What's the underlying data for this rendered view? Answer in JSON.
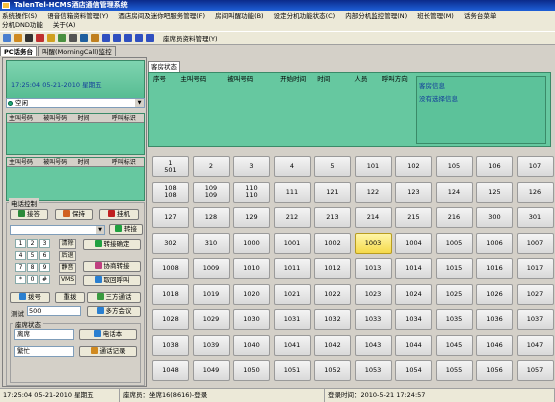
{
  "window": {
    "title": "TalenTel-HCMS酒店通信管理系统"
  },
  "menu": [
    "系统操作(S)",
    "语音信箱资料管理(Y)",
    "酒店房间及迷你吧服务管理(F)",
    "房间叫醒功能(B)",
    "设定分机功能状态(C)",
    "内部分机监控管理(N)",
    "班长管理(M)",
    "话务台菜单",
    "分机DND功能",
    "关于(A)"
  ],
  "toolbar": {
    "label": "座席员资料管理(Y)",
    "icons": [
      "open-icon",
      "filter-icon",
      "clock-icon",
      "ring-icon",
      "flag-icon",
      "users-icon",
      "printer-icon",
      "phone-icon",
      "key-icon",
      "check-icon",
      "check-icon",
      "check-icon",
      "check-icon",
      "check-icon"
    ]
  },
  "tabs": [
    "PC话务台",
    "叫醒(MorningCall)监控"
  ],
  "clock": "17:25:04  05-21-2010 星期五",
  "agent_state": "空闲",
  "queue1_head": [
    "主叫号码",
    "被叫号码",
    "时间",
    "呼叫标识"
  ],
  "queue2_head": [
    "主叫号码",
    "被叫号码",
    "时间",
    "呼叫标识"
  ],
  "control": {
    "title": "电话控制",
    "answer": "接答",
    "hold": "保持",
    "hangup": "挂机",
    "transfer": "转接",
    "clear": "清除",
    "transfer_confirm": "转接确定",
    "callback": "后退",
    "mute": "静音",
    "consult": "协商转接",
    "vms": "VMS",
    "reject": "取回呼叫",
    "dial": "拨号",
    "redial": "重拨",
    "three_way": "三方通话",
    "test": "测试",
    "test_value": "500",
    "conference": "多方会议"
  },
  "keys": [
    "1",
    "2",
    "3",
    "4",
    "5",
    "6",
    "7",
    "8",
    "9",
    "*",
    "0",
    "#"
  ],
  "seat_status": {
    "title": "座席状态",
    "status_value": "离席",
    "notebook": "电话本",
    "busy": "繁忙",
    "call_log": "通话记录"
  },
  "seat_tab": "客房状态",
  "seat_cols": [
    "序号",
    "主叫号码",
    "被叫号码",
    "开始时间",
    "时间",
    "人员",
    "呼叫方向"
  ],
  "seat_info": {
    "title": "客房信息",
    "value": "没有选择信息"
  },
  "extensions": [
    [
      "1\n501",
      "2",
      "3",
      "4",
      "5",
      "101",
      "102",
      "105",
      "106",
      "107"
    ],
    [
      "108\n108",
      "109\n109",
      "110\n110",
      "111",
      "121",
      "122",
      "123",
      "124",
      "125",
      "126"
    ],
    [
      "127",
      "128",
      "129",
      "212",
      "213",
      "214",
      "215",
      "216",
      "300",
      "301"
    ],
    [
      "302",
      "310",
      "1000",
      "1001",
      "1002",
      "1003",
      "1004",
      "1005",
      "1006",
      "1007"
    ],
    [
      "1008",
      "1009",
      "1010",
      "1011",
      "1012",
      "1013",
      "1014",
      "1015",
      "1016",
      "1017"
    ],
    [
      "1018",
      "1019",
      "1020",
      "1021",
      "1022",
      "1023",
      "1024",
      "1025",
      "1026",
      "1027"
    ],
    [
      "1028",
      "1029",
      "1030",
      "1031",
      "1032",
      "1033",
      "1034",
      "1035",
      "1036",
      "1037"
    ],
    [
      "1038",
      "1039",
      "1040",
      "1041",
      "1042",
      "1043",
      "1044",
      "1045",
      "1046",
      "1047"
    ],
    [
      "1048",
      "1049",
      "1050",
      "1051",
      "1052",
      "1053",
      "1054",
      "1055",
      "1056",
      "1057"
    ]
  ],
  "highlighted": "1003",
  "statusbar": [
    "17:25:04 05-21-2010 星期五",
    "座席员：坐席16(8616)-登录",
    "登录时间：2010-5-21  17:24:57"
  ]
}
